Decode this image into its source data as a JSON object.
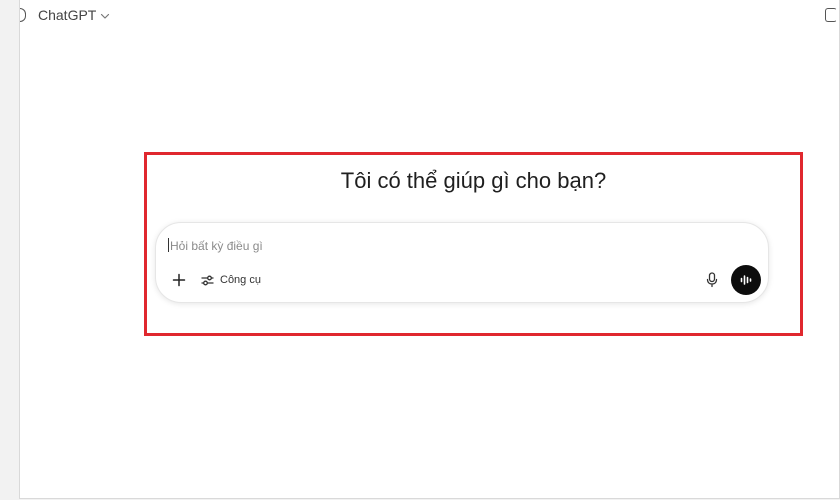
{
  "header": {
    "model_name": "ChatGPT",
    "dropdown_icon": "chevron-down-icon"
  },
  "main": {
    "greeting": "Tôi có thể giúp gì cho bạn?"
  },
  "composer": {
    "placeholder": "Hỏi bất kỳ điều gì",
    "value": "",
    "add_icon": "plus-icon",
    "tools_icon": "sliders-icon",
    "tools_label": "Công cụ",
    "mic_icon": "microphone-icon",
    "voice_icon": "voice-mode-icon"
  },
  "colors": {
    "highlight_border": "#e0282e",
    "voice_button": "#0d0d0d",
    "background": "#ffffff"
  }
}
